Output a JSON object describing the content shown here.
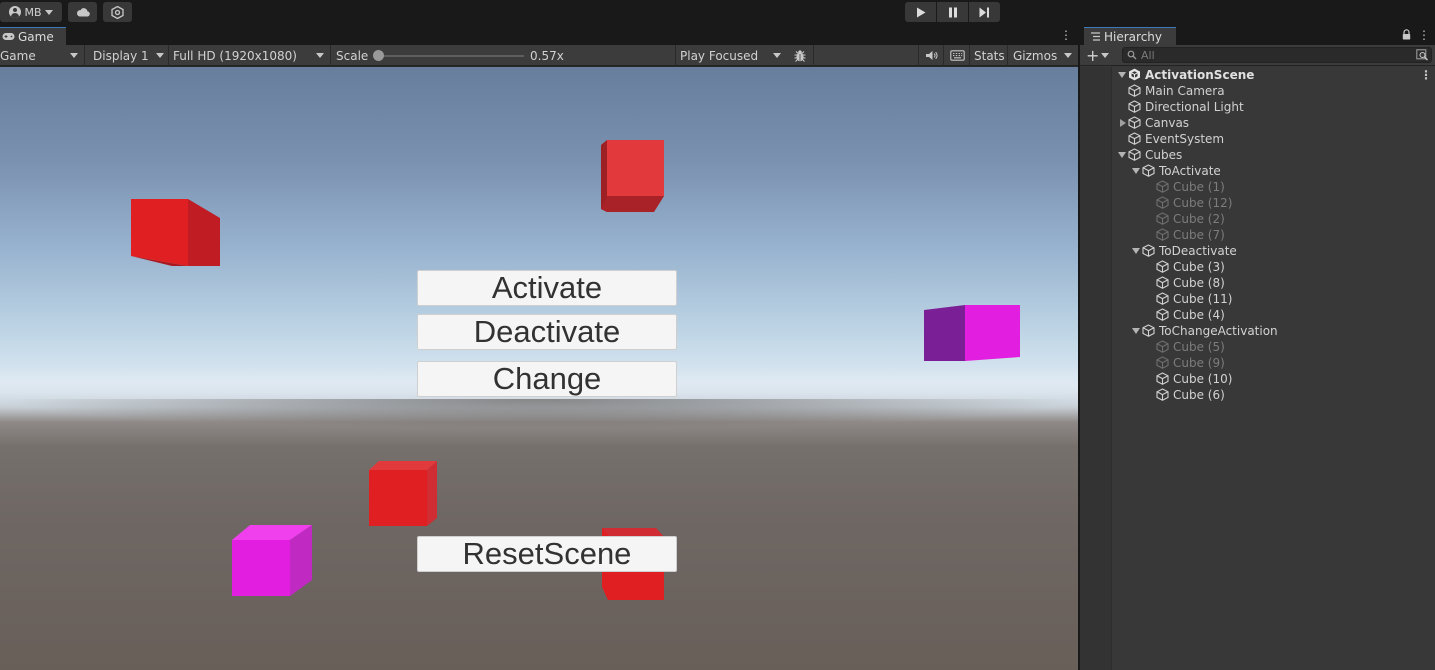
{
  "toolbar": {
    "account_label": "MB",
    "icons": [
      "account-icon",
      "cloud-icon",
      "settings-icon",
      "play-icon",
      "pause-icon",
      "step-icon"
    ]
  },
  "game_panel": {
    "tab_label": "Game",
    "mode_dropdown": "Game",
    "display_dropdown": "Display 1",
    "resolution_dropdown": "Full HD (1920x1080)",
    "scale_label": "Scale",
    "scale_value": "0.57x",
    "scale_fraction": 0.0,
    "play_mode_dropdown": "Play Focused",
    "stats_label": "Stats",
    "gizmos_label": "Gizmos"
  },
  "scene": {
    "buttons": {
      "activate": "Activate",
      "deactivate": "Deactivate",
      "change": "Change",
      "reset": "ResetScene"
    },
    "colors": {
      "red_cube": "#e01f23",
      "magenta_cube": "#e21ee0",
      "purple_face": "#7a1f96"
    }
  },
  "hierarchy": {
    "tab_label": "Hierarchy",
    "search_placeholder": "All",
    "scene_name": "ActivationScene",
    "items": [
      {
        "label": "Main Camera",
        "depth": 1,
        "expander": "none",
        "active": true
      },
      {
        "label": "Directional Light",
        "depth": 1,
        "expander": "none",
        "active": true
      },
      {
        "label": "Canvas",
        "depth": 1,
        "expander": "collapsed",
        "active": true
      },
      {
        "label": "EventSystem",
        "depth": 1,
        "expander": "none",
        "active": true
      },
      {
        "label": "Cubes",
        "depth": 1,
        "expander": "expanded",
        "active": true
      },
      {
        "label": "ToActivate",
        "depth": 2,
        "expander": "expanded",
        "active": true
      },
      {
        "label": "Cube (1)",
        "depth": 3,
        "expander": "none",
        "active": false
      },
      {
        "label": "Cube (12)",
        "depth": 3,
        "expander": "none",
        "active": false
      },
      {
        "label": "Cube (2)",
        "depth": 3,
        "expander": "none",
        "active": false
      },
      {
        "label": "Cube (7)",
        "depth": 3,
        "expander": "none",
        "active": false
      },
      {
        "label": "ToDeactivate",
        "depth": 2,
        "expander": "expanded",
        "active": true
      },
      {
        "label": "Cube (3)",
        "depth": 3,
        "expander": "none",
        "active": true
      },
      {
        "label": "Cube (8)",
        "depth": 3,
        "expander": "none",
        "active": true
      },
      {
        "label": "Cube (11)",
        "depth": 3,
        "expander": "none",
        "active": true
      },
      {
        "label": "Cube (4)",
        "depth": 3,
        "expander": "none",
        "active": true
      },
      {
        "label": "ToChangeActivation",
        "depth": 2,
        "expander": "expanded",
        "active": true
      },
      {
        "label": "Cube (5)",
        "depth": 3,
        "expander": "none",
        "active": false
      },
      {
        "label": "Cube (9)",
        "depth": 3,
        "expander": "none",
        "active": false
      },
      {
        "label": "Cube (10)",
        "depth": 3,
        "expander": "none",
        "active": true
      },
      {
        "label": "Cube (6)",
        "depth": 3,
        "expander": "none",
        "active": true
      }
    ]
  }
}
